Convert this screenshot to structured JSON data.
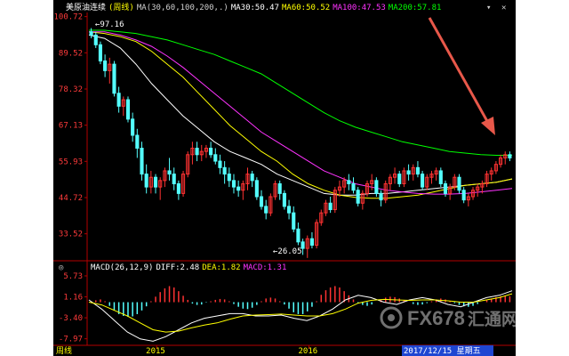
{
  "window_controls": {
    "menu": "▾",
    "close": "✕"
  },
  "main_header": [
    {
      "text": "美原油连续",
      "color": "#ffffff"
    },
    {
      "text": "(周线)",
      "color": "#ffff00"
    },
    {
      "text": "MA(30,60,100,200,.)",
      "color": "#cfcfcf"
    },
    {
      "text": "MA30:50.47",
      "color": "#ffffff"
    },
    {
      "text": "MA60:50.52",
      "color": "#ffff00"
    },
    {
      "text": "MA100:47.53",
      "color": "#ff33ff"
    },
    {
      "text": "MA200:57.81",
      "color": "#00ff00"
    }
  ],
  "macd_header": [
    {
      "text": "MACD(26,12,9)",
      "color": "#ffffff"
    },
    {
      "text": "DIFF:2.48",
      "color": "#ffffff"
    },
    {
      "text": "DEA:1.82",
      "color": "#ffff00"
    },
    {
      "text": "MACD:1.31",
      "color": "#ff33ff"
    }
  ],
  "annotations": {
    "high": "97.16",
    "low": "26.05"
  },
  "footer": {
    "period_label": "周线",
    "date_badge": "2017/12/15 星期五"
  },
  "watermark": {
    "logo_text": "FX678",
    "cn_text": "汇通网"
  },
  "colors": {
    "up": "#ff3232",
    "down": "#54ffff",
    "ma30": "#ffffff",
    "ma60": "#ffff00",
    "ma100": "#ff33ff",
    "ma200": "#00ff00",
    "axis": "#b40000",
    "arrow": "#e8584a"
  },
  "chart_data": [
    {
      "type": "candlestick",
      "title": "美原油连续(周线)",
      "ylim": [
        26.0,
        102.0
      ],
      "y_ticks": [
        "100.72",
        "89.52",
        "78.32",
        "67.13",
        "55.93",
        "44.72",
        "33.52"
      ],
      "x_ticks": [
        "2015",
        "2016",
        "2017"
      ],
      "series": [
        {
          "name": "MA30",
          "values": [
            95.0,
            94.0,
            91.0,
            86.0,
            80.0,
            75.0,
            70.0,
            66.0,
            62.0,
            59.0,
            57.0,
            55.0,
            52.0,
            50.0,
            48.0,
            46.0,
            45.5,
            45.5,
            46.0,
            46.0,
            46.5,
            47.0,
            47.5,
            48.0,
            48.5,
            49.0,
            49.5,
            50.47
          ]
        },
        {
          "name": "MA60",
          "values": [
            96.0,
            95.5,
            94.5,
            93.0,
            90.0,
            86.0,
            82.0,
            77.0,
            72.0,
            67.0,
            63.0,
            59.0,
            56.0,
            52.0,
            49.0,
            47.0,
            45.5,
            44.8,
            44.5,
            44.5,
            45.0,
            45.5,
            46.5,
            47.5,
            48.5,
            49.0,
            49.5,
            50.52
          ]
        },
        {
          "name": "MA100",
          "values": [
            96.0,
            96.0,
            95.0,
            93.5,
            91.5,
            88.5,
            85.0,
            81.0,
            77.0,
            73.0,
            69.0,
            65.0,
            62.0,
            59.0,
            56.0,
            53.0,
            51.0,
            49.0,
            48.0,
            47.0,
            46.5,
            46.0,
            45.8,
            45.8,
            46.0,
            46.5,
            47.0,
            47.53
          ]
        },
        {
          "name": "MA200",
          "values": [
            96.5,
            96.5,
            96.0,
            95.5,
            94.5,
            93.5,
            92.0,
            90.5,
            89.0,
            87.0,
            85.0,
            83.0,
            80.0,
            77.0,
            74.0,
            71.0,
            68.5,
            66.5,
            65.0,
            63.5,
            62.0,
            61.0,
            60.0,
            59.0,
            58.5,
            58.0,
            57.8,
            57.81
          ]
        }
      ],
      "ohlc": [
        [
          96,
          97.16,
          94,
          95
        ],
        [
          95,
          96,
          91,
          92
        ],
        [
          92,
          93,
          86,
          87
        ],
        [
          87,
          89,
          82,
          84
        ],
        [
          84,
          88,
          80,
          86
        ],
        [
          86,
          87,
          76,
          77
        ],
        [
          77,
          79,
          71,
          73
        ],
        [
          73,
          76,
          70,
          75
        ],
        [
          75,
          76,
          68,
          69
        ],
        [
          69,
          71,
          62,
          64
        ],
        [
          64,
          66,
          57,
          60
        ],
        [
          60,
          62,
          50,
          52
        ],
        [
          52,
          55,
          46,
          48
        ],
        [
          48,
          53,
          46,
          51
        ],
        [
          51,
          52,
          46,
          48
        ],
        [
          48,
          51,
          44,
          50
        ],
        [
          50,
          54,
          48,
          53
        ],
        [
          53,
          57,
          50,
          52
        ],
        [
          52,
          54,
          47,
          49
        ],
        [
          49,
          50,
          44,
          46
        ],
        [
          46,
          53,
          45,
          52
        ],
        [
          52,
          59,
          51,
          58
        ],
        [
          58,
          62,
          55,
          60
        ],
        [
          60,
          62,
          56,
          58
        ],
        [
          58,
          61,
          56,
          59
        ],
        [
          59,
          61,
          57,
          60
        ],
        [
          60,
          62,
          57,
          58
        ],
        [
          58,
          60,
          55,
          56
        ],
        [
          56,
          58,
          52,
          54
        ],
        [
          54,
          56,
          49,
          52
        ],
        [
          52,
          54,
          48,
          50
        ],
        [
          50,
          52,
          46,
          48
        ],
        [
          48,
          50,
          45,
          47
        ],
        [
          47,
          50,
          44,
          49
        ],
        [
          49,
          54,
          47,
          52
        ],
        [
          52,
          53,
          48,
          50
        ],
        [
          50,
          51,
          44,
          45
        ],
        [
          45,
          47,
          41,
          42
        ],
        [
          42,
          44,
          38,
          40
        ],
        [
          40,
          46,
          39,
          45
        ],
        [
          45,
          50,
          44,
          49
        ],
        [
          49,
          50,
          44,
          46
        ],
        [
          46,
          47,
          41,
          42
        ],
        [
          42,
          44,
          38,
          40
        ],
        [
          40,
          42,
          34,
          35
        ],
        [
          35,
          37,
          30,
          31
        ],
        [
          31,
          32,
          27,
          29
        ],
        [
          29,
          33,
          26.05,
          32
        ],
        [
          32,
          34,
          29,
          30
        ],
        [
          30,
          38,
          29,
          37
        ],
        [
          37,
          41,
          36,
          40
        ],
        [
          40,
          44,
          39,
          43
        ],
        [
          43,
          45,
          40,
          41
        ],
        [
          41,
          48,
          40,
          47
        ],
        [
          47,
          50,
          45,
          48
        ],
        [
          48,
          51,
          46,
          50
        ],
        [
          50,
          52,
          47,
          49
        ],
        [
          49,
          51,
          46,
          47
        ],
        [
          47,
          48,
          42,
          43
        ],
        [
          43,
          47,
          41,
          46
        ],
        [
          46,
          50,
          45,
          49
        ],
        [
          49,
          52,
          47,
          50
        ],
        [
          50,
          51,
          45,
          46
        ],
        [
          46,
          47,
          42,
          44
        ],
        [
          44,
          50,
          43,
          49
        ],
        [
          49,
          52,
          47,
          51
        ],
        [
          51,
          54,
          49,
          52
        ],
        [
          52,
          53,
          48,
          49
        ],
        [
          49,
          54,
          48,
          53
        ],
        [
          53,
          55,
          50,
          52
        ],
        [
          52,
          55,
          50,
          54
        ],
        [
          54,
          56,
          51,
          52
        ],
        [
          52,
          53,
          47,
          48
        ],
        [
          48,
          52,
          47,
          51
        ],
        [
          51,
          53,
          49,
          52
        ],
        [
          52,
          54,
          50,
          53
        ],
        [
          53,
          54,
          48,
          49
        ],
        [
          49,
          50,
          45,
          46
        ],
        [
          46,
          49,
          44,
          48
        ],
        [
          48,
          52,
          47,
          51
        ],
        [
          51,
          52,
          46,
          47
        ],
        [
          47,
          48,
          43,
          44
        ],
        [
          44,
          46,
          42,
          45
        ],
        [
          45,
          48,
          44,
          47
        ],
        [
          47,
          49,
          45,
          48
        ],
        [
          48,
          50,
          46,
          49
        ],
        [
          49,
          53,
          48,
          52
        ],
        [
          52,
          54,
          50,
          53
        ],
        [
          53,
          56,
          52,
          55
        ],
        [
          55,
          58,
          54,
          57
        ],
        [
          57,
          59,
          55,
          58
        ],
        [
          58,
          59,
          56,
          57
        ]
      ]
    },
    {
      "type": "macd",
      "title": "MACD(26,12,9)",
      "ylim": [
        -9.2,
        6.5
      ],
      "y_ticks": [
        "5.73",
        "1.16",
        "-3.40",
        "-7.97"
      ],
      "series": [
        {
          "name": "DIFF",
          "values": [
            0.5,
            -1.5,
            -4.0,
            -6.5,
            -8.0,
            -8.5,
            -7.5,
            -6.0,
            -4.5,
            -3.5,
            -3.0,
            -2.5,
            -2.5,
            -3.0,
            -3.0,
            -2.8,
            -3.5,
            -4.0,
            -3.0,
            -1.5,
            0.5,
            1.5,
            1.0,
            0.0,
            -0.5,
            0.5,
            1.0,
            0.5,
            -0.5,
            -1.0,
            0.0,
            1.0,
            1.5,
            2.48
          ]
        },
        {
          "name": "DEA",
          "values": [
            0.0,
            -0.6,
            -1.8,
            -3.0,
            -4.5,
            -6.0,
            -6.5,
            -6.3,
            -5.6,
            -5.0,
            -4.5,
            -3.7,
            -3.0,
            -2.8,
            -2.7,
            -2.6,
            -2.8,
            -3.0,
            -3.0,
            -2.5,
            -1.5,
            -0.2,
            0.4,
            0.6,
            0.5,
            0.4,
            0.5,
            0.5,
            0.3,
            0.0,
            0.0,
            0.5,
            1.0,
            1.82
          ]
        },
        {
          "name": "MACD",
          "values": [
            0.2,
            0.4,
            0.6,
            0.2,
            -0.8,
            -1.8,
            -2.6,
            -3.0,
            -3.2,
            -3.1,
            -2.6,
            -1.8,
            -0.9,
            0.2,
            1.2,
            2.2,
            3.0,
            3.5,
            3.2,
            2.4,
            1.4,
            0.5,
            -0.3,
            -0.6,
            -0.5,
            -0.1,
            0.2,
            0.5,
            0.7,
            0.6,
            0.2,
            -0.4,
            -1.0,
            -1.4,
            -1.5,
            -1.2,
            -0.6,
            0.2,
            0.8,
            1.0,
            0.8,
            0.2,
            -0.5,
            -1.4,
            -2.2,
            -2.6,
            -2.6,
            -2.0,
            -1.0,
            0.2,
            1.6,
            2.6,
            3.2,
            3.5,
            3.2,
            2.4,
            1.5,
            0.6,
            -0.2,
            -0.6,
            -0.8,
            -0.5,
            0.0,
            0.6,
            1.0,
            1.2,
            1.1,
            0.8,
            0.4,
            0.0,
            -0.4,
            -0.6,
            -0.5,
            -0.2,
            0.2,
            0.6,
            0.8,
            0.6,
            0.2,
            -0.2,
            -0.6,
            -0.9,
            -1.0,
            -0.8,
            -0.4,
            0.0,
            0.4,
            0.8,
            1.1,
            1.3,
            1.4,
            1.3
          ]
        }
      ]
    }
  ]
}
